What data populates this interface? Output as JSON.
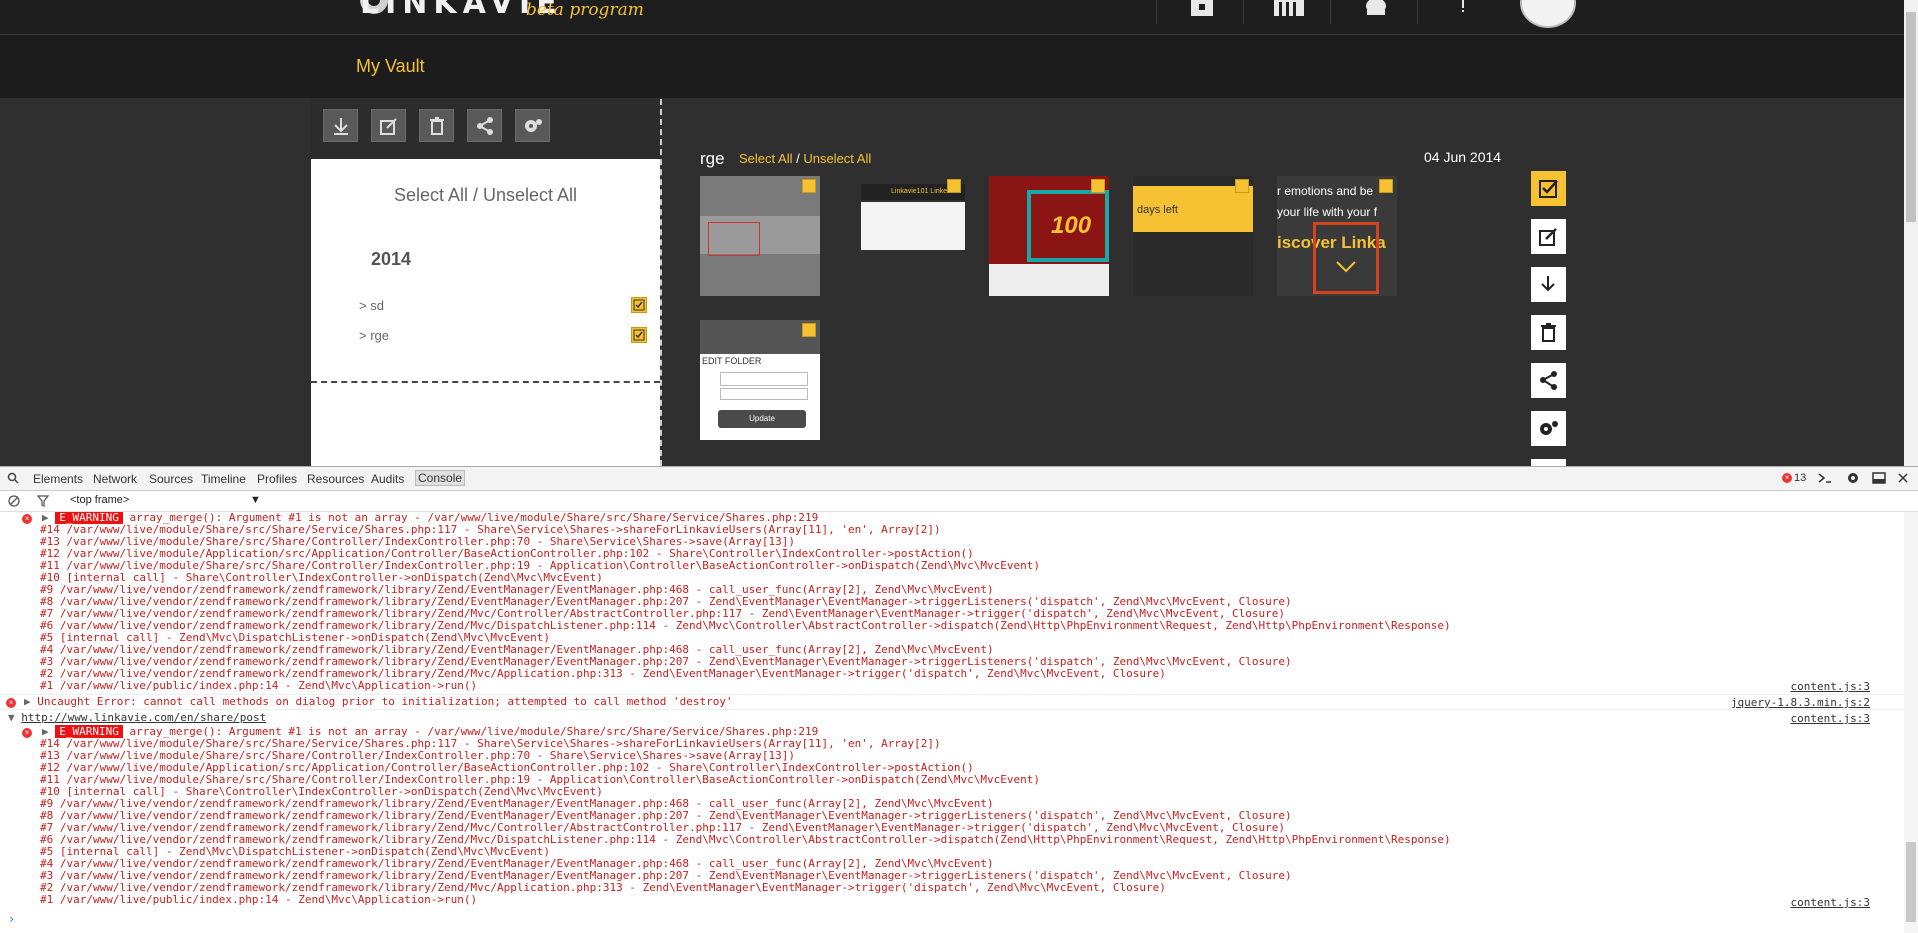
{
  "site": {
    "logo_text": "LINKAVIE",
    "logo_sub": "beta program",
    "page_title": "My Vault",
    "nav_icons": [
      "vault-icon",
      "library-icon",
      "friends-icon",
      "more-icon"
    ],
    "toolstrip_icons": [
      "download-icon",
      "edit-icon",
      "trash-icon",
      "share-icon",
      "settings-icon"
    ],
    "select_all": "Select All / Unselect All",
    "year": "2014",
    "folders": [
      {
        "label": "> sd",
        "checked": true
      },
      {
        "label": "> rge",
        "checked": true
      }
    ],
    "gallery": {
      "folder_name": "rge",
      "select_all": "Select All",
      "separator": " / ",
      "unselect_all": "Unselect All",
      "date": "04 Jun 2014",
      "thumb_texts": {
        "t2": "Linkavie101 Linke",
        "t3": "100",
        "t4": "days left",
        "t5_line1": "r emotions and be",
        "t5_line2": "your life with your f",
        "t5_line3": "iscover Linka",
        "t6_title": "EDIT FOLDER",
        "t6_button": "Update"
      }
    },
    "right_actions": [
      "check-icon",
      "edit-icon",
      "download-icon",
      "trash-icon",
      "share-icon",
      "settings-icon"
    ],
    "accent": "#f6c233"
  },
  "devtools": {
    "tabs": [
      "Elements",
      "Network",
      "Sources",
      "Timeline",
      "Profiles",
      "Resources",
      "Audits",
      "Console"
    ],
    "active_tab": "Console",
    "error_count": "13",
    "frame_select": "<top frame>",
    "warning_label": "E_WARNING",
    "block1": {
      "header": " array_merge(): Argument #1 is not an array - /var/www/live/module/Share/src/Share/Service/Shares.php:219",
      "lines": [
        "#14 /var/www/live/module/Share/src/Share/Service/Shares.php:117 - Share\\Service\\Shares->shareForLinkavieUsers(Array[11], 'en', Array[2])",
        "#13 /var/www/live/module/Share/src/Share/Controller/IndexController.php:70 - Share\\Service\\Shares->save(Array[13])",
        "#12 /var/www/live/module/Application/src/Application/Controller/BaseActionController.php:102 - Share\\Controller\\IndexController->postAction()",
        "#11 /var/www/live/module/Share/src/Share/Controller/IndexController.php:19 - Application\\Controller\\BaseActionController->onDispatch(Zend\\Mvc\\MvcEvent)",
        "#10 [internal call] - Share\\Controller\\IndexController->onDispatch(Zend\\Mvc\\MvcEvent)",
        "#9 /var/www/live/vendor/zendframework/zendframework/library/Zend/EventManager/EventManager.php:468 - call_user_func(Array[2], Zend\\Mvc\\MvcEvent)",
        "#8 /var/www/live/vendor/zendframework/zendframework/library/Zend/EventManager/EventManager.php:207 - Zend\\EventManager\\EventManager->triggerListeners('dispatch', Zend\\Mvc\\MvcEvent, Closure)",
        "#7 /var/www/live/vendor/zendframework/zendframework/library/Zend/Mvc/Controller/AbstractController.php:117 - Zend\\EventManager\\EventManager->trigger('dispatch', Zend\\Mvc\\MvcEvent, Closure)",
        "#6 /var/www/live/vendor/zendframework/zendframework/library/Zend/Mvc/DispatchListener.php:114 - Zend\\Mvc\\Controller\\AbstractController->dispatch(Zend\\Http\\PhpEnvironment\\Request, Zend\\Http\\PhpEnvironment\\Response)",
        "#5 [internal call] - Zend\\Mvc\\DispatchListener->onDispatch(Zend\\Mvc\\MvcEvent)",
        "#4 /var/www/live/vendor/zendframework/zendframework/library/Zend/EventManager/EventManager.php:468 - call_user_func(Array[2], Zend\\Mvc\\MvcEvent)",
        "#3 /var/www/live/vendor/zendframework/zendframework/library/Zend/EventManager/EventManager.php:207 - Zend\\EventManager\\EventManager->triggerListeners('dispatch', Zend\\Mvc\\MvcEvent, Closure)",
        "#2 /var/www/live/vendor/zendframework/zendframework/library/Zend/Mvc/Application.php:313 - Zend\\EventManager\\EventManager->trigger('dispatch', Zend\\Mvc\\MvcEvent, Closure)",
        "#1 /var/www/live/public/index.php:14 - Zend\\Mvc\\Application->run()"
      ],
      "source": "content.js:3"
    },
    "uncaught": {
      "text": "Uncaught Error: cannot call methods on dialog prior to initialization; attempted to call method 'destroy'",
      "source": "jquery-1.8.3.min.js:2"
    },
    "url_group": {
      "url": "http://www.linkavie.com/en/share/post",
      "source": "content.js:3"
    },
    "block2": {
      "header": " array_merge(): Argument #1 is not an array - /var/www/live/module/Share/src/Share/Service/Shares.php:219",
      "source": "content.js:3"
    }
  }
}
